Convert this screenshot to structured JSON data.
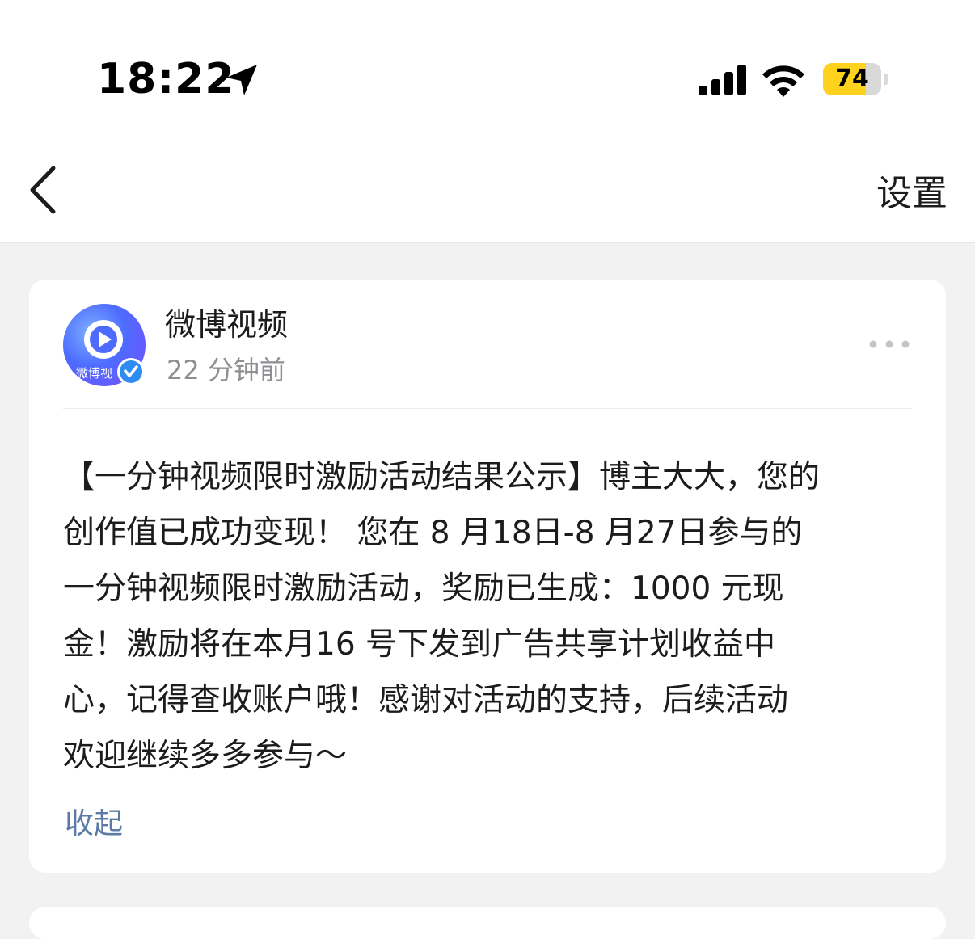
{
  "status_bar": {
    "time": "18:22",
    "location_icon": "location-arrow-icon",
    "signal_icon": "cellular-signal-icon",
    "wifi_icon": "wifi-icon",
    "battery_level": "74",
    "battery_fraction": 0.74,
    "battery_color": "#ffd21e"
  },
  "nav": {
    "back_icon": "chevron-left-icon",
    "settings_label": "设置"
  },
  "post": {
    "author": {
      "name": "微博视频",
      "avatar_label": "微博视",
      "verified_icon": "verified-check-icon"
    },
    "time": "22 分钟前",
    "more_icon": "more-dots-icon",
    "body_lines": [
      "【一分钟视频限时激励活动结果公示】博主大大，您的",
      "创作值已成功变现！ 您在 8 月18日-8 月27日参与的",
      "一分钟视频限时激励活动，奖励已生成：1000 元现",
      "金！激励将在本月16 号下发到广告共享计划收益中",
      "心，记得查收账户哦！感谢对活动的支持，后续活动",
      "欢迎继续多多参与～"
    ],
    "collapse_label": "收起",
    "link_color": "#5b7ba6"
  }
}
